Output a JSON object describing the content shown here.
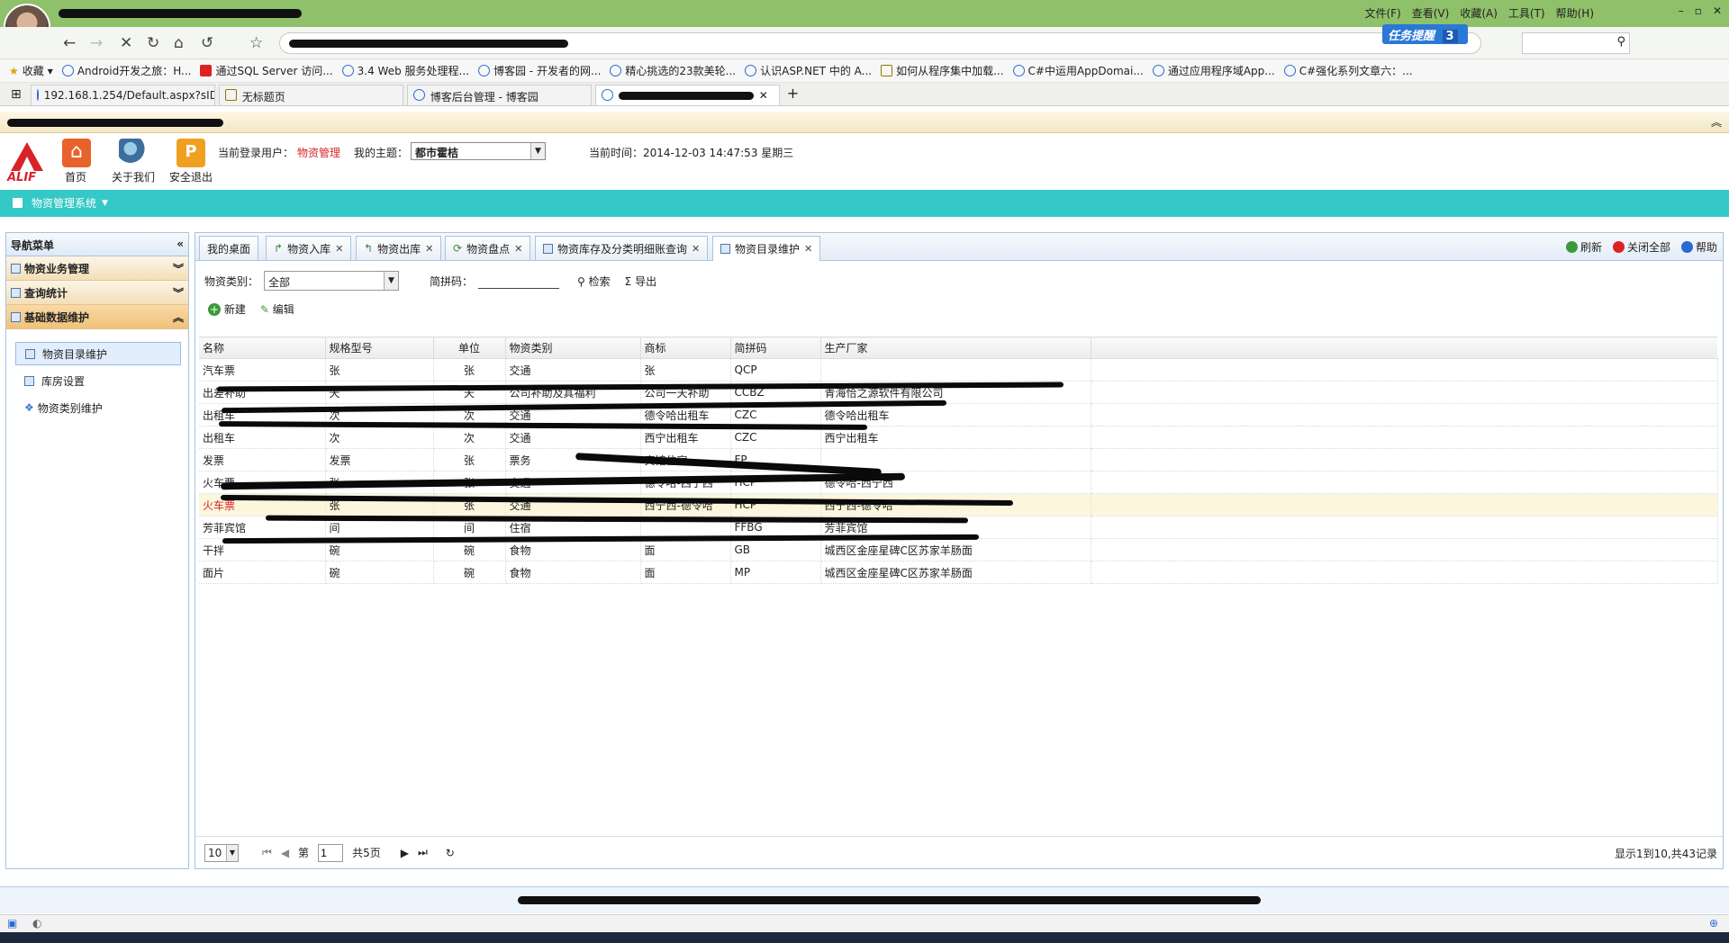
{
  "browser": {
    "menu": [
      "文件(F)",
      "查看(V)",
      "收藏(A)",
      "工具(T)",
      "帮助(H)"
    ],
    "task_remind": "任务提醒",
    "task_count": "3",
    "bookmarks": [
      {
        "label": "收藏"
      },
      {
        "label": "Android开发之旅：H..."
      },
      {
        "label": "通过SQL Server 访问..."
      },
      {
        "label": "3.4 Web 服务处理程..."
      },
      {
        "label": "博客园 - 开发者的网..."
      },
      {
        "label": "精心挑选的23款美轮..."
      },
      {
        "label": "认识ASP.NET 中的 A..."
      },
      {
        "label": "如何从程序集中加载..."
      },
      {
        "label": "C#中运用AppDomai..."
      },
      {
        "label": "通过应用程序域App..."
      },
      {
        "label": "C#强化系列文章六：..."
      }
    ],
    "tabs": [
      {
        "label": "192.168.1.254/Default.aspx?sID="
      },
      {
        "label": "无标题页"
      },
      {
        "label": "博客后台管理 - 博客园"
      }
    ]
  },
  "header": {
    "nav": [
      {
        "label": "首页"
      },
      {
        "label": "关于我们"
      },
      {
        "label": "安全退出"
      }
    ],
    "logo_text": "ALIF",
    "user_label": "当前登录用户：",
    "user_value": "物资管理",
    "theme_label": "我的主题：",
    "theme_value": "都市霍桔",
    "time_label": "当前时间：",
    "time_value": "2014-12-03 14:47:53 星期三"
  },
  "sysmenu": "物资管理系统",
  "sidebar": {
    "title": "导航菜单",
    "groups": [
      {
        "label": "物资业务管理"
      },
      {
        "label": "查询统计"
      },
      {
        "label": "基础数据维护"
      }
    ],
    "items": [
      {
        "label": "物资目录维护"
      },
      {
        "label": "库房设置"
      },
      {
        "label": "物资类别维护"
      }
    ]
  },
  "tabs": [
    {
      "label": "我的桌面"
    },
    {
      "label": "物资入库"
    },
    {
      "label": "物资出库"
    },
    {
      "label": "物资盘点"
    },
    {
      "label": "物资库存及分类明细账查询"
    },
    {
      "label": "物资目录维护"
    }
  ],
  "tools": {
    "refresh": "刷新",
    "close_all": "关闭全部",
    "help": "帮助"
  },
  "filter": {
    "category_label": "物资类别：",
    "category_value": "全部",
    "py_label": "简拼码：",
    "search": "检索",
    "export": "导出"
  },
  "actions": {
    "new": "新建",
    "edit": "编辑"
  },
  "grid": {
    "columns": [
      "名称",
      "规格型号",
      "单位",
      "物资类别",
      "商标",
      "简拼码",
      "生产厂家"
    ],
    "rows": [
      [
        "汽车票",
        "张",
        "张",
        "交通",
        "张",
        "QCP",
        ""
      ],
      [
        "出差补助",
        "天",
        "天",
        "公司补助及其福利",
        "公司一天补助",
        "CCBZ",
        "青海恰之源软件有限公司"
      ],
      [
        "出租车",
        "次",
        "次",
        "交通",
        "德令哈出租车",
        "CZC",
        "德令哈出租车"
      ],
      [
        "出租车",
        "次",
        "次",
        "交通",
        "西宁出租车",
        "CZC",
        "西宁出租车"
      ],
      [
        "发票",
        "发票",
        "张",
        "票务",
        "宾馆住宿",
        "FP",
        ""
      ],
      [
        "火车票",
        "张",
        "张",
        "交通",
        "德令哈-西宁西",
        "HCP",
        "德令哈-西宁西"
      ],
      [
        "火车票",
        "张",
        "张",
        "交通",
        "西宁西-德令哈",
        "HCP",
        "西宁西-德令哈"
      ],
      [
        "芳菲宾馆",
        "间",
        "间",
        "住宿",
        "",
        "FFBG",
        "芳菲宾馆"
      ],
      [
        "干拌",
        "碗",
        "碗",
        "食物",
        "面",
        "GB",
        "城西区金座星碑C区苏家羊肠面"
      ],
      [
        "面片",
        "碗",
        "碗",
        "食物",
        "面",
        "MP",
        "城西区金座星碑C区苏家羊肠面"
      ]
    ]
  },
  "pager": {
    "size": "10",
    "page_prefix": "第",
    "page_value": "1",
    "page_suffix": "共5页",
    "info": "显示1到10,共43记录"
  }
}
